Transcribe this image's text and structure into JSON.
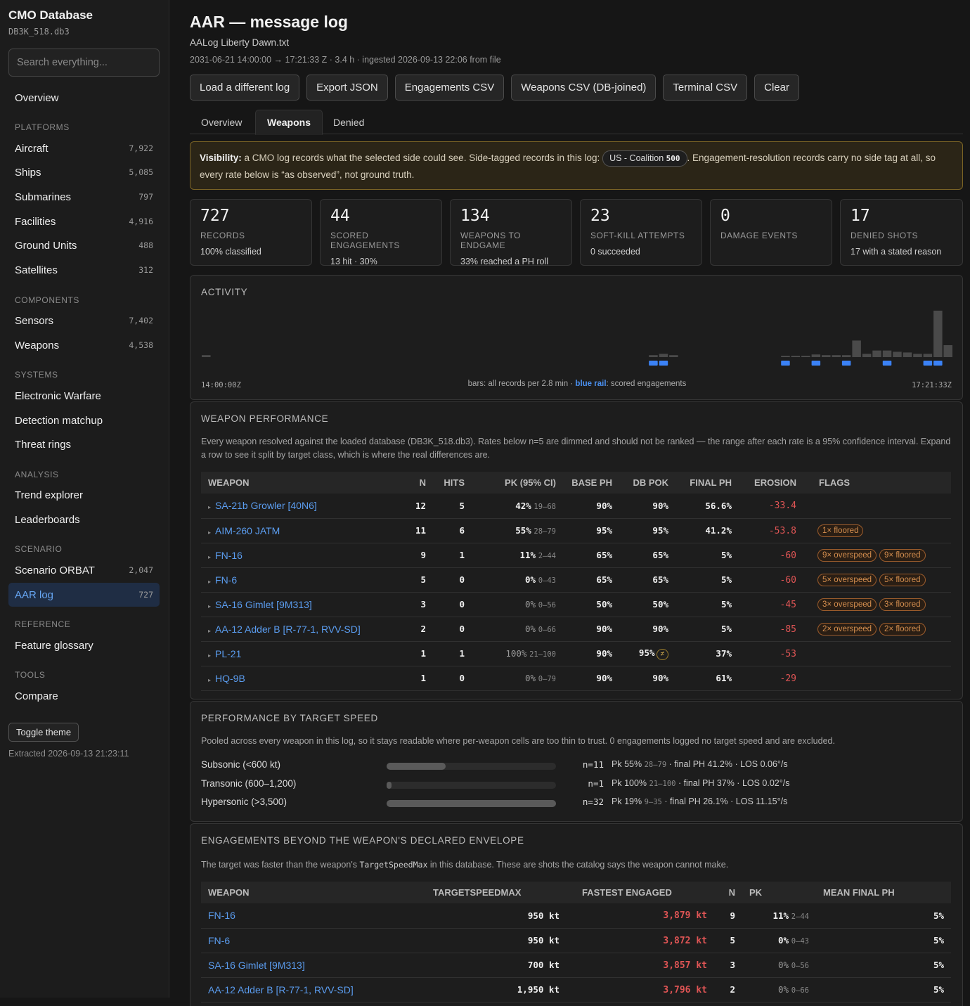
{
  "sidebar": {
    "brand": "CMO Database",
    "db_file": "DB3K_518.db3",
    "search_placeholder": "Search everything...",
    "overview": "Overview",
    "sections": {
      "platforms": "PLATFORMS",
      "components": "COMPONENTS",
      "systems": "SYSTEMS",
      "analysis": "ANALYSIS",
      "scenario": "SCENARIO",
      "reference": "REFERENCE",
      "tools": "TOOLS"
    },
    "items": {
      "aircraft": {
        "label": "Aircraft",
        "count": "7,922"
      },
      "ships": {
        "label": "Ships",
        "count": "5,085"
      },
      "submarines": {
        "label": "Submarines",
        "count": "797"
      },
      "facilities": {
        "label": "Facilities",
        "count": "4,916"
      },
      "ground_units": {
        "label": "Ground Units",
        "count": "488"
      },
      "satellites": {
        "label": "Satellites",
        "count": "312"
      },
      "sensors": {
        "label": "Sensors",
        "count": "7,402"
      },
      "weapons": {
        "label": "Weapons",
        "count": "4,538"
      },
      "ew": {
        "label": "Electronic Warfare"
      },
      "detection": {
        "label": "Detection matchup"
      },
      "threat": {
        "label": "Threat rings"
      },
      "trend": {
        "label": "Trend explorer"
      },
      "leader": {
        "label": "Leaderboards"
      },
      "orbat": {
        "label": "Scenario ORBAT",
        "count": "2,047"
      },
      "aar": {
        "label": "AAR log",
        "count": "727"
      },
      "glossary": {
        "label": "Feature glossary"
      },
      "compare": {
        "label": "Compare"
      }
    },
    "toggle_theme": "Toggle theme",
    "extracted": "Extracted 2026-09-13 21:23:11"
  },
  "header": {
    "title": "AAR — message log",
    "file": "AALog Liberty Dawn.txt",
    "meta": "2031-06-21 14:00:00 → 17:21:33 Z · 3.4 h · ingested 2026-09-13 22:06 from file"
  },
  "actions": [
    "Load a different log",
    "Export JSON",
    "Engagements CSV",
    "Weapons CSV (DB-joined)",
    "Terminal CSV",
    "Clear"
  ],
  "tabs": [
    "Overview",
    "Weapons",
    "Denied"
  ],
  "visibility": {
    "label": "Visibility:",
    "text1": " a CMO log records what the selected side could see. Side-tagged records in this log: ",
    "chip_side": "US - Coalition",
    "chip_count": "500",
    "text2": ". Engagement-resolution records carry no side tag at all, so every rate below is “as observed”, not ground truth."
  },
  "stats": [
    {
      "num": "727",
      "label": "RECORDS",
      "note": "100% classified"
    },
    {
      "num": "44",
      "label": "SCORED ENGAGEMENTS",
      "note": "13 hit · 30%"
    },
    {
      "num": "134",
      "label": "WEAPONS TO ENDGAME",
      "note": "33% reached a PH roll"
    },
    {
      "num": "23",
      "label": "SOFT-KILL ATTEMPTS",
      "note": "0 succeeded"
    },
    {
      "num": "0",
      "label": "DAMAGE EVENTS",
      "note": ""
    },
    {
      "num": "17",
      "label": "DENIED SHOTS",
      "note": "17 with a stated reason"
    }
  ],
  "activity": {
    "title": "ACTIVITY",
    "start": "14:00:00Z",
    "end": "17:21:33Z",
    "legend_pre": "bars: all records per 2.8 min · ",
    "legend_blue": "blue rail",
    "legend_post": ": scored engagements"
  },
  "chart_data": {
    "type": "bar",
    "bar_values": [
      3,
      0,
      0,
      0,
      0,
      0,
      0,
      0,
      0,
      0,
      0,
      0,
      0,
      0,
      0,
      0,
      0,
      0,
      0,
      0,
      0,
      0,
      0,
      0,
      0,
      0,
      0,
      0,
      0,
      0,
      0,
      0,
      0,
      0,
      0,
      0,
      0,
      0,
      0,
      0,
      0,
      0,
      0,
      0,
      3,
      5,
      3,
      0,
      0,
      0,
      0,
      0,
      0,
      0,
      0,
      0,
      0,
      2,
      2,
      2,
      4,
      3,
      3,
      3,
      25,
      5,
      10,
      10,
      8,
      7,
      5,
      5,
      70,
      18
    ],
    "scored_bins": [
      44,
      45,
      57,
      60,
      63,
      67,
      71,
      72
    ],
    "ylim": [
      0,
      72
    ]
  },
  "weapon_perf": {
    "title": "WEAPON PERFORMANCE",
    "desc": "Every weapon resolved against the loaded database (DB3K_518.db3). Rates below n=5 are dimmed and should not be ranked — the range after each rate is a 95% confidence interval. Expand a row to see it split by target class, which is where the real differences are.",
    "columns": [
      "WEAPON",
      "N",
      "HITS",
      "PK (95% CI)",
      "BASE PH",
      "DB POK",
      "FINAL PH",
      "EROSION",
      "FLAGS"
    ],
    "rows": [
      {
        "weapon": "SA-21b Growler [40N6]",
        "n": "12",
        "hits": "5",
        "pk": "42%",
        "ci": "19–68",
        "base": "90%",
        "pok": "90%",
        "final": "56.6%",
        "erosion": "-33.4",
        "flags": []
      },
      {
        "weapon": "AIM-260 JATM",
        "n": "11",
        "hits": "6",
        "pk": "55%",
        "ci": "28–79",
        "base": "95%",
        "pok": "95%",
        "final": "41.2%",
        "erosion": "-53.8",
        "flags": [
          "1× floored"
        ]
      },
      {
        "weapon": "FN-16",
        "n": "9",
        "hits": "1",
        "pk": "11%",
        "ci": "2–44",
        "base": "65%",
        "pok": "65%",
        "final": "5%",
        "erosion": "-60",
        "flags": [
          "9× overspeed",
          "9× floored"
        ]
      },
      {
        "weapon": "FN-6",
        "n": "5",
        "hits": "0",
        "pk": "0%",
        "ci": "0–43",
        "base": "65%",
        "pok": "65%",
        "final": "5%",
        "erosion": "-60",
        "flags": [
          "5× overspeed",
          "5× floored"
        ]
      },
      {
        "weapon": "SA-16 Gimlet [9M313]",
        "n": "3",
        "hits": "0",
        "pk": "0%",
        "ci": "0–56",
        "base": "50%",
        "pok": "50%",
        "final": "5%",
        "erosion": "-45",
        "flags": [
          "3× overspeed",
          "3× floored"
        ],
        "dim": true
      },
      {
        "weapon": "AA-12 Adder B [R-77-1, RVV-SD]",
        "n": "2",
        "hits": "0",
        "pk": "0%",
        "ci": "0–66",
        "base": "90%",
        "pok": "90%",
        "final": "5%",
        "erosion": "-85",
        "flags": [
          "2× overspeed",
          "2× floored"
        ],
        "dim": true
      },
      {
        "weapon": "PL-21",
        "n": "1",
        "hits": "1",
        "pk": "100%",
        "ci": "21–100",
        "base": "90%",
        "pok": "95%",
        "pok_flag": "≠",
        "final": "37%",
        "erosion": "-53",
        "flags": [],
        "dim": true
      },
      {
        "weapon": "HQ-9B",
        "n": "1",
        "hits": "0",
        "pk": "0%",
        "ci": "0–79",
        "base": "90%",
        "pok": "90%",
        "final": "61%",
        "erosion": "-29",
        "flags": [],
        "dim": true
      }
    ]
  },
  "speed": {
    "title": "PERFORMANCE BY TARGET SPEED",
    "desc": "Pooled across every weapon in this log, so it stays readable where per-weapon cells are too thin to trust. 0 engagements logged no target speed and are excluded.",
    "rows": [
      {
        "label": "Subsonic (<600 kt)",
        "n": "n=11",
        "pk": "55%",
        "ci": "28–79",
        "rest": " · final PH 41.2% · LOS 0.06°/s",
        "fill": 0.35
      },
      {
        "label": "Transonic (600–1,200)",
        "n": "n=1",
        "pk": "100%",
        "ci": "21–100",
        "rest": " · final PH 37% · LOS 0.02°/s",
        "fill": 0.03
      },
      {
        "label": "Hypersonic (>3,500)",
        "n": "n=32",
        "pk": "19%",
        "ci": "9–35",
        "rest": " · final PH 26.1% · LOS 11.15°/s",
        "fill": 1.0
      }
    ]
  },
  "envelope": {
    "title": "ENGAGEMENTS BEYOND THE WEAPON'S DECLARED ENVELOPE",
    "desc_pre": "The target was faster than the weapon's ",
    "desc_code": "TargetSpeedMax",
    "desc_post": " in this database. These are shots the catalog says the weapon cannot make.",
    "columns": [
      "WEAPON",
      "TARGETSPEEDMAX",
      "FASTEST ENGAGED",
      "N",
      "PK",
      "MEAN FINAL PH"
    ],
    "rows": [
      {
        "weapon": "FN-16",
        "max": "950 kt",
        "fastest": "3,879 kt",
        "n": "9",
        "pk": "11%",
        "ci": "2–44",
        "mean": "5%"
      },
      {
        "weapon": "FN-6",
        "max": "950 kt",
        "fastest": "3,872 kt",
        "n": "5",
        "pk": "0%",
        "ci": "0–43",
        "mean": "5%"
      },
      {
        "weapon": "SA-16 Gimlet [9M313]",
        "max": "700 kt",
        "fastest": "3,857 kt",
        "n": "3",
        "pk": "0%",
        "ci": "0–56",
        "mean": "5%",
        "dim": true
      },
      {
        "weapon": "AA-12 Adder B [R-77-1, RVV-SD]",
        "max": "1,950 kt",
        "fastest": "3,796 kt",
        "n": "2",
        "pk": "0%",
        "ci": "0–66",
        "mean": "5%",
        "dim": true
      }
    ]
  },
  "colors": {
    "accent": "#5b9df0",
    "scored_rail": "#3b82f6",
    "warn_border": "#7a6325",
    "erosion": "#e05555",
    "flag": "#d58f4f"
  }
}
